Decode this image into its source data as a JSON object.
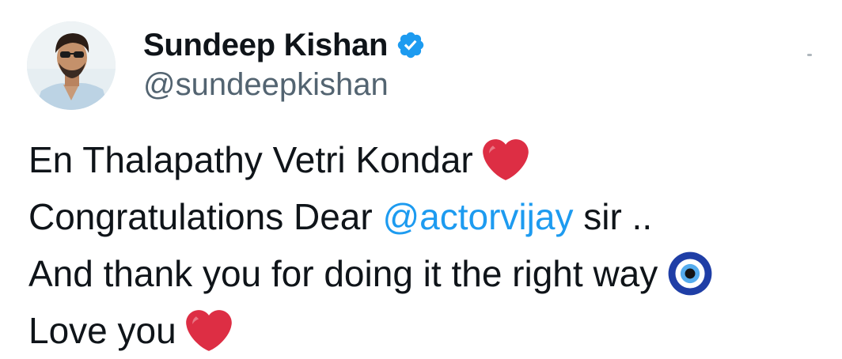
{
  "author": {
    "display_name": "Sundeep Kishan",
    "handle": "@sundeepkishan",
    "verified": true,
    "accent_color": "#1d9bf0"
  },
  "icons": {
    "verified": "verified-badge-icon",
    "heart": "red-heart-icon",
    "evil_eye": "nazar-amulet-icon",
    "more": "more-icon"
  },
  "tweet": {
    "line1": {
      "text": "En Thalapathy Vetri Kondar",
      "emoji": "red-heart"
    },
    "line2": {
      "prefix": "Congratulations Dear ",
      "mention": "@actorvijay",
      "suffix": " sir .."
    },
    "line3": {
      "text": "And thank you for doing it the right way",
      "emoji": "nazar-amulet"
    },
    "line4": {
      "text": "Love you",
      "emoji": "red-heart"
    }
  }
}
